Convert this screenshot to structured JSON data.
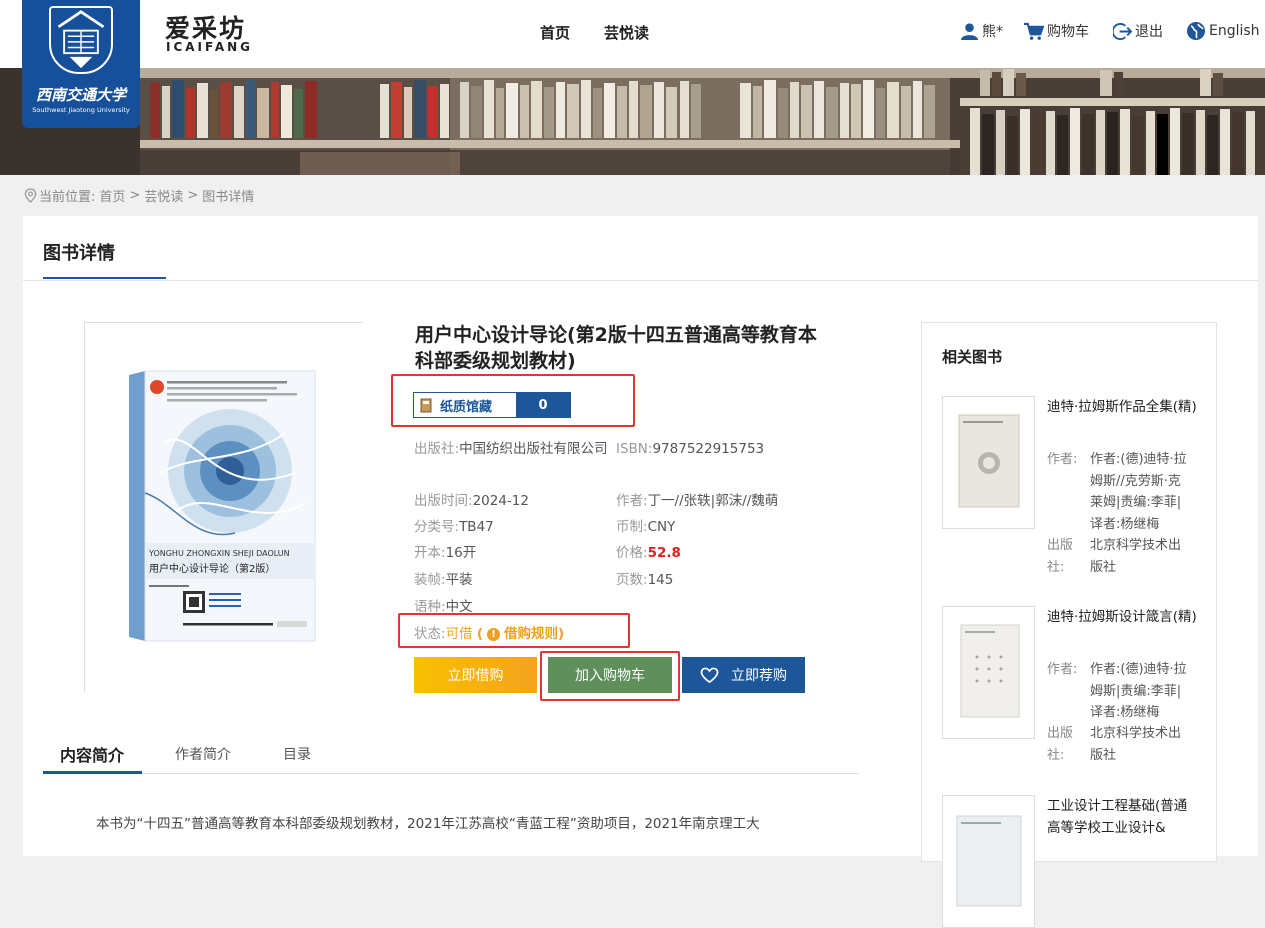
{
  "header": {
    "university_name": "西南交通大学",
    "university_en": "Southwest Jiaotong University",
    "brand_cn": "爱采坊",
    "brand_en": "ICAIFANG",
    "nav": [
      "首页",
      "芸悦读"
    ],
    "user": "熊*",
    "cart": "购物车",
    "logout": "退出",
    "language": "English"
  },
  "breadcrumb": {
    "prefix": "当前位置:",
    "items": [
      "首页",
      "芸悦读",
      "图书详情"
    ],
    "separator": ">"
  },
  "section_title": "图书详情",
  "book": {
    "title": "用户中心设计导论(第2版十四五普通高等教育本科部委级规划教材)",
    "holding_label": "纸质馆藏",
    "holding_count": "0",
    "cover_title_pinyin": "YONGHU ZHONGXIN SHEJI DAOLUN",
    "cover_title": "用户中心设计导论（第2版）",
    "fields": {
      "publisher_k": "出版社:",
      "publisher_v": "中国纺织出版社有限公司",
      "isbn_k": "ISBN:",
      "isbn_v": "9787522915753",
      "date_k": "出版时间:",
      "date_v": "2024-12",
      "author_k": "作者:",
      "author_v": "丁一//张轶|郭沫//魏萌",
      "class_k": "分类号:",
      "class_v": "TB47",
      "currency_k": "币制:",
      "currency_v": "CNY",
      "format_k": "开本:",
      "format_v": "16开",
      "price_k": "价格:",
      "price_v": "52.8",
      "binding_k": "装帧:",
      "binding_v": "平装",
      "pages_k": "页数:",
      "pages_v": "145",
      "lang_k": "语种:",
      "lang_v": "中文",
      "status_k": "状态:",
      "status_v": "可借",
      "rule_open": "(",
      "rule_label": "借购规则",
      "rule_close": ")"
    },
    "buttons": {
      "borrow": "立即借购",
      "cart": "加入购物车",
      "reserve": "立即荐购"
    }
  },
  "tabs": [
    "内容简介",
    "作者简介",
    "目录"
  ],
  "intro_text": "本书为“十四五”普通高等教育本科部委级规划教材，2021年江苏高校“青蓝工程”资助项目，2021年南京理工大",
  "related": {
    "title": "相关图书",
    "items": [
      {
        "name": "迪特·拉姆斯作品全集(精)",
        "author_k": "作者:",
        "author_v": "作者:(德)迪特·拉姆斯//克劳斯·克莱姆|责编:李菲|译者:杨继梅",
        "publisher_k": "出版社:",
        "publisher_v": "北京科学技术出版社"
      },
      {
        "name": "迪特·拉姆斯设计箴言(精)",
        "author_k": "作者:",
        "author_v": "作者:(德)迪特·拉姆斯|责编:李菲|译者:杨继梅",
        "publisher_k": "出版社:",
        "publisher_v": "北京科学技术出版社"
      },
      {
        "name": "工业设计工程基础(普通高等学校工业设计&"
      }
    ]
  },
  "colors": {
    "brand_blue": "#1e5799",
    "price_red": "#e02020",
    "status_orange": "#f0a020",
    "cart_green": "#5f8f5b",
    "highlight_red": "#e53333"
  }
}
